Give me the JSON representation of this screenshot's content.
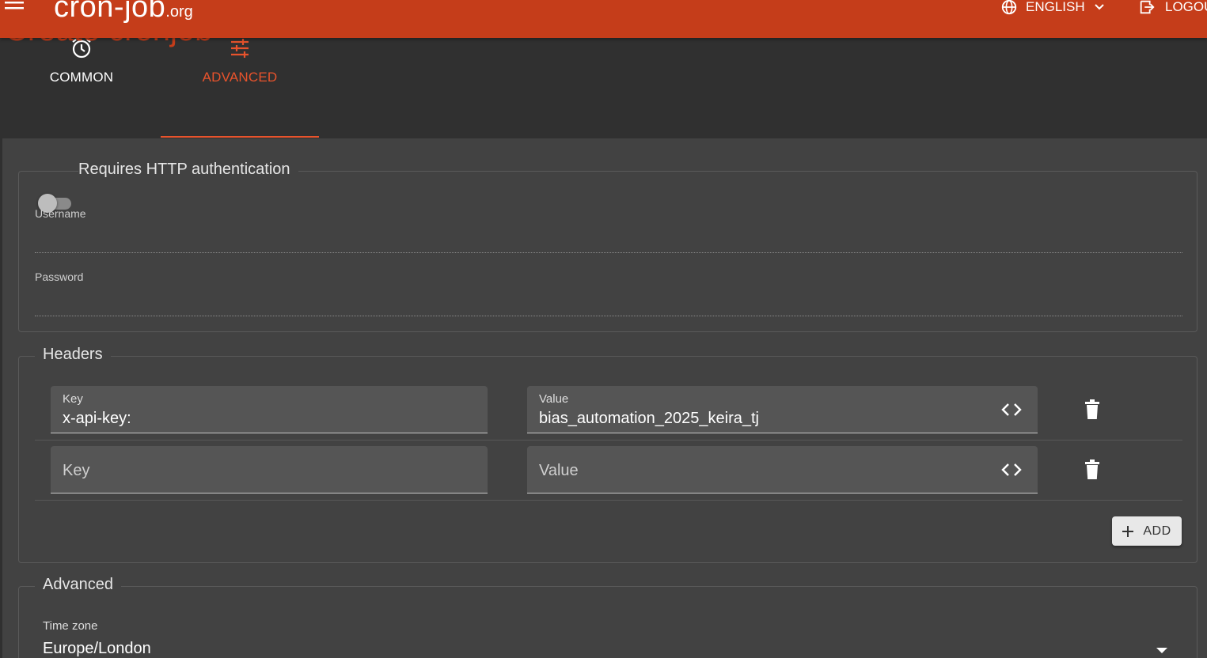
{
  "app": {
    "logo_main": "cron-job",
    "logo_tld": ".org",
    "language_label": "ENGLISH",
    "logout_label": "LOGOU",
    "page_title": "Create cronjob"
  },
  "tabs": [
    {
      "label": "COMMON",
      "icon": "alarm-clock-icon",
      "active": false
    },
    {
      "label": "ADVANCED",
      "icon": "tune-sliders-icon",
      "active": true
    }
  ],
  "auth": {
    "toggle_label": "Requires HTTP authentication",
    "enabled": false,
    "username_label": "Username",
    "username_value": "",
    "password_label": "Password",
    "password_value": ""
  },
  "headers": {
    "title": "Headers",
    "rows": [
      {
        "key_label": "Key",
        "key_value": "x-api-key:",
        "value_label": "Value",
        "value_value": "bias_automation_2025_keira_tj"
      },
      {
        "key_placeholder": "Key",
        "value_placeholder": "Value"
      }
    ],
    "add_label": "ADD"
  },
  "advanced": {
    "title": "Advanced",
    "timezone_label": "Time zone",
    "timezone_value": "Europe/London"
  },
  "colors": {
    "appbar": "#c53d1a",
    "accent": "#e8532c",
    "background": "#303030",
    "panel": "#424242"
  }
}
